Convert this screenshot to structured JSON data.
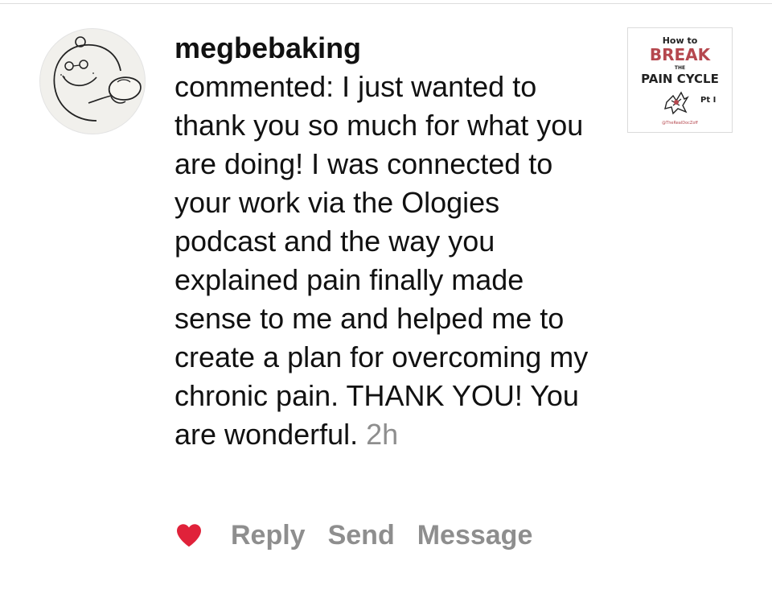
{
  "comment": {
    "username": "megbebaking",
    "text": "commented: I just wanted to thank you so much for what you are doing! I was connected to your work via the Ologies podcast and the way you explained pain finally made sense to me and helped me to create a plan for overcoming my chronic pain. THANK YOU! You are wonderful.",
    "time": "2h"
  },
  "avatar": {
    "icon": "cartoon-avatar-icon"
  },
  "post_thumbnail": {
    "line1": "How to",
    "line2": "BREAK",
    "line3": "THE",
    "line4": "PAIN CYCLE",
    "part": "Pt I",
    "handle": "@TheRealDocZoff",
    "accent_color": "#b5474e"
  },
  "actions": {
    "like_icon": "heart-icon",
    "like_color": "#e0223a",
    "reply_label": "Reply",
    "send_label": "Send",
    "message_label": "Message"
  }
}
